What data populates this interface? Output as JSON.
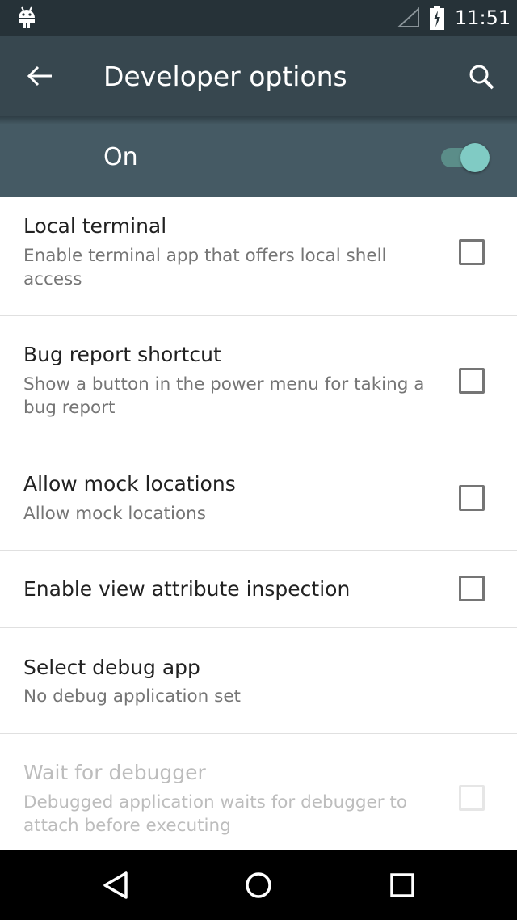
{
  "status_bar": {
    "time": "11:51"
  },
  "toolbar": {
    "title": "Developer options"
  },
  "master_switch": {
    "label": "On",
    "checked": true
  },
  "settings": [
    {
      "title": "Local terminal",
      "summary": "Enable terminal app that offers local shell access",
      "checked": false,
      "enabled": true
    },
    {
      "title": "Bug report shortcut",
      "summary": "Show a button in the power menu for taking a bug report",
      "checked": false,
      "enabled": true
    },
    {
      "title": "Allow mock locations",
      "summary": "Allow mock locations",
      "checked": false,
      "enabled": true
    },
    {
      "title": "Enable view attribute inspection",
      "checked": false,
      "enabled": true
    },
    {
      "title": "Select debug app",
      "summary": "No debug application set",
      "enabled": true
    },
    {
      "title": "Wait for debugger",
      "summary": "Debugged application waits for debugger to attach before executing",
      "checked": false,
      "enabled": false
    }
  ],
  "colors": {
    "status_bar": "#263238",
    "toolbar": "#37474f",
    "switch_bar": "#455a64",
    "accent": "#80cbc4"
  },
  "icons": {
    "status": [
      "android-debug-icon",
      "signal-icon",
      "battery-charging-icon"
    ],
    "toolbar": [
      "arrow-back-icon",
      "search-icon"
    ],
    "navigation": [
      "back-triangle-icon",
      "home-circle-icon",
      "recents-square-icon"
    ]
  }
}
